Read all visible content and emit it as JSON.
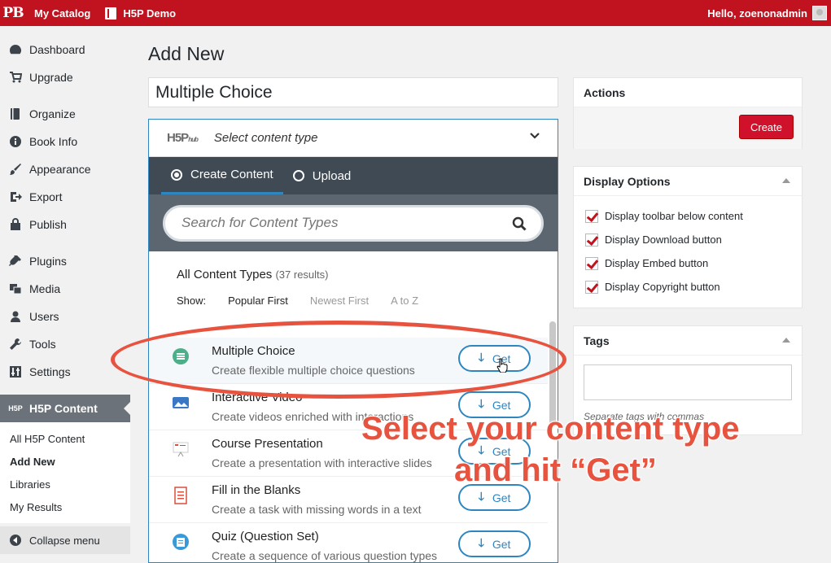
{
  "adminbar": {
    "logo": "PB",
    "catalog": "My Catalog",
    "site": "H5P Demo",
    "howdy": "Hello, zoenonadmin"
  },
  "sidebar": {
    "items": [
      {
        "label": "Dashboard",
        "icon": "dashboard-icon"
      },
      {
        "label": "Upgrade",
        "icon": "cart-icon"
      },
      {
        "label": "Organize",
        "icon": "organize-icon"
      },
      {
        "label": "Book Info",
        "icon": "info-icon"
      },
      {
        "label": "Appearance",
        "icon": "brush-icon"
      },
      {
        "label": "Export",
        "icon": "export-icon"
      },
      {
        "label": "Publish",
        "icon": "publish-icon"
      },
      {
        "label": "Plugins",
        "icon": "plug-icon"
      },
      {
        "label": "Media",
        "icon": "media-icon"
      },
      {
        "label": "Users",
        "icon": "user-icon"
      },
      {
        "label": "Tools",
        "icon": "wrench-icon"
      },
      {
        "label": "Settings",
        "icon": "settings-icon"
      }
    ],
    "current": {
      "label": "H5P Content",
      "icon_text": "H5P"
    },
    "submenu": [
      "All H5P Content",
      "Add New",
      "Libraries",
      "My Results"
    ],
    "collapse": "Collapse menu"
  },
  "main": {
    "title": "Add New",
    "title_value": "Multiple Choice",
    "hub": {
      "logo": "H5P",
      "logo_sub": "hub",
      "select_text": "Select content type",
      "tabs": [
        "Create Content",
        "Upload"
      ],
      "search_placeholder": "Search for Content Types",
      "list_title": "All Content Types",
      "list_count": "(37 results)",
      "show_label": "Show:",
      "sort_options": [
        "Popular First",
        "Newest First",
        "A to Z"
      ],
      "get_label": "Get",
      "content_types": [
        {
          "title": "Multiple Choice",
          "desc": "Create flexible multiple choice questions",
          "color": "#4caf8a"
        },
        {
          "title": "Interactive Video",
          "desc": "Create videos enriched with interactions",
          "color": "#3a78c4"
        },
        {
          "title": "Course Presentation",
          "desc": "Create a presentation with interactive slides",
          "color": "#d94f3d"
        },
        {
          "title": "Fill in the Blanks",
          "desc": "Create a task with missing words in a text",
          "color": "#d94f3d"
        },
        {
          "title": "Quiz (Question Set)",
          "desc": "Create a sequence of various question types",
          "color": "#3a9ad9"
        }
      ]
    }
  },
  "actions": {
    "title": "Actions",
    "create": "Create"
  },
  "display_options": {
    "title": "Display Options",
    "options": [
      "Display toolbar below content",
      "Display Download button",
      "Display Embed button",
      "Display Copyright button"
    ]
  },
  "tags": {
    "title": "Tags",
    "hint": "Separate tags with commas"
  },
  "annotation": {
    "line1": "Select your content type",
    "line2": "and hit “Get”",
    "color": "#e8533f"
  }
}
